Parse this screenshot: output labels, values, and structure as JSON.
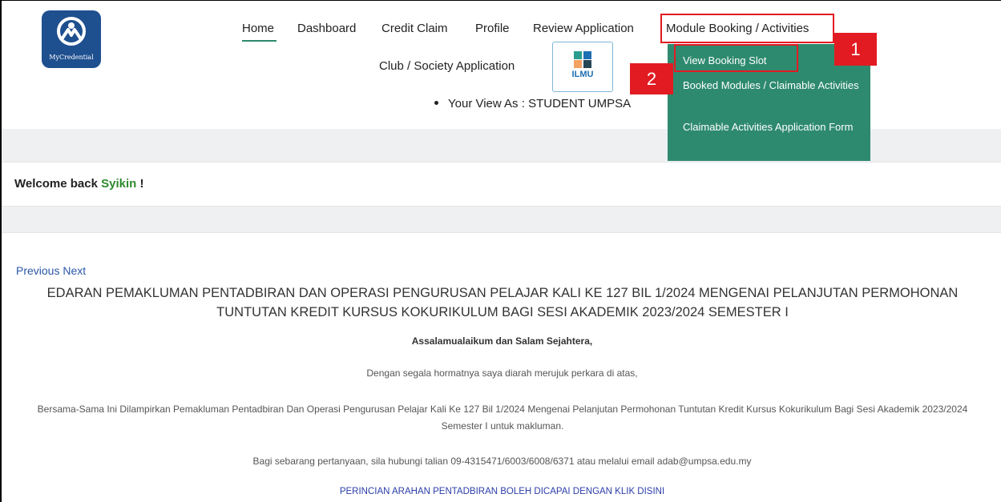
{
  "logo": {
    "text": "MyCredential"
  },
  "nav": {
    "home": "Home",
    "dashboard": "Dashboard",
    "credit_claim": "Credit Claim",
    "profile": "Profile",
    "review_application": "Review Application",
    "module_booking": "Module Booking / Activities",
    "club_society": "Club / Society Application",
    "ilmu_label": "ILMU",
    "view_as": "Your View As : STUDENT UMPSA"
  },
  "dropdown": {
    "items": [
      "View Booking Slot",
      "Booked Modules / Claimable Activities",
      "Claimable Activities Application Form"
    ]
  },
  "annotations": {
    "label_1": "1",
    "label_2": "2",
    "color": "#e21b23"
  },
  "welcome": {
    "prefix": "Welcome back ",
    "name": "Syikin",
    "suffix": " !"
  },
  "carousel": {
    "controls": "Previous Next"
  },
  "announcement": {
    "headline": "EDARAN PEMAKLUMAN PENTADBIRAN DAN OPERASI PENGURUSAN PELAJAR KALI KE 127 BIL 1/2024 MENGENAI PELANJUTAN PERMOHONAN TUNTUTAN KREDIT KURSUS KOKURIKULUM BAGI SESI AKADEMIK 2023/2024 SEMESTER I",
    "greeting": "Assalamualaikum dan Salam Sejahtera,",
    "para_1": "Dengan segala hormatnya saya diarah merujuk perkara di atas,",
    "para_2": "Bersama-Sama Ini Dilampirkan Pemakluman Pentadbiran Dan Operasi Pengurusan Pelajar Kali Ke 127 Bil 1/2024 Mengenai Pelanjutan Permohonan Tuntutan Kredit Kursus Kokurikulum Bagi Sesi Akademik 2023/2024 Semester I untuk makluman.",
    "para_3": "Bagi sebarang pertanyaan, sila hubungi talian 09-4315471/6003/6008/6371 atau melalui email adab@umpsa.edu.my",
    "link": "PERINCIAN ARAHAN PENTADBIRAN BOLEH DICAPAI DENGAN KLIK DISINI"
  },
  "colors": {
    "accent": "#2e8a6e",
    "logo_bg": "#1e4f8f",
    "link": "#2b57a8",
    "band": "#eef0f2"
  }
}
